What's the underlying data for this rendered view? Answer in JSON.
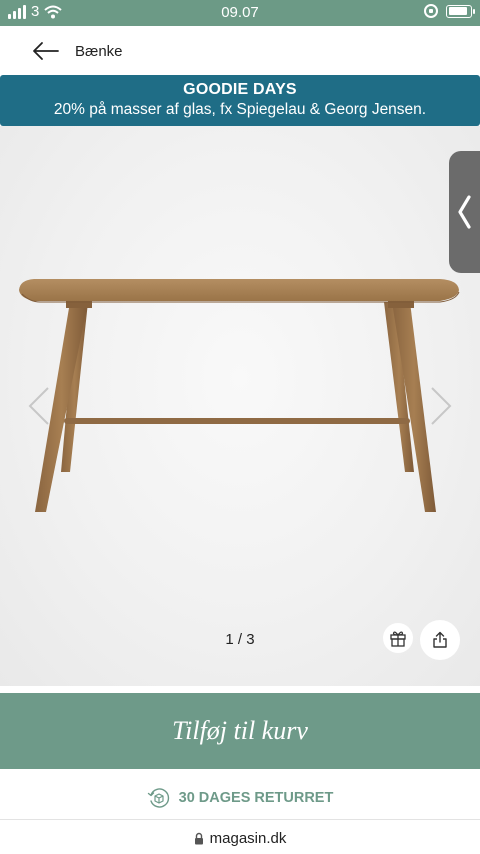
{
  "status_bar": {
    "carrier": "3",
    "time": "09.07",
    "battery_level": 0.9
  },
  "nav": {
    "title": "Bænke"
  },
  "promo": {
    "title": "GOODIE DAYS",
    "subtitle": "20% på masser af glas, fx Spiegelau & Georg Jensen."
  },
  "gallery": {
    "pager": "1 / 3"
  },
  "cart": {
    "label": "Tilføj til kurv"
  },
  "returns": {
    "label": "30 DAGES RETURRET"
  },
  "browser": {
    "url": "magasin.dk"
  },
  "colors": {
    "accent": "#6e9a89",
    "promo": "#1f6d86",
    "status": "#6c9a86"
  }
}
